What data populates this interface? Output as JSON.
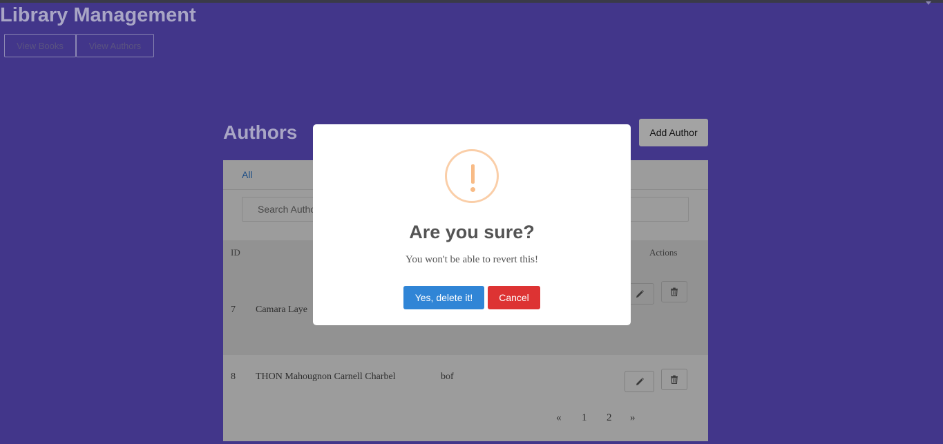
{
  "app": {
    "title": "Library Management"
  },
  "nav": {
    "books_label": "View Books",
    "authors_label": "View Authors"
  },
  "authors": {
    "title": "Authors",
    "add_button": "Add Author",
    "tab_all": "All",
    "search_placeholder": "Search Authors",
    "columns": {
      "id": "ID",
      "actions": "Actions"
    },
    "rows": [
      {
        "id": "7",
        "name": "Camara Laye",
        "description": ""
      },
      {
        "id": "8",
        "name": "THON Mahougnon Carnell Charbel",
        "description": "bof"
      }
    ],
    "pagination": {
      "prev": "«",
      "pages": [
        "1",
        "2"
      ],
      "next": "»"
    }
  },
  "modal": {
    "icon": "warning-icon",
    "title": "Are you sure?",
    "text": "You won't be able to revert this!",
    "confirm_label": "Yes, delete it!",
    "cancel_label": "Cancel"
  },
  "colors": {
    "background": "#42368a",
    "confirm": "#3085d6",
    "cancel": "#dd3333",
    "warning": "#f8bb86"
  }
}
